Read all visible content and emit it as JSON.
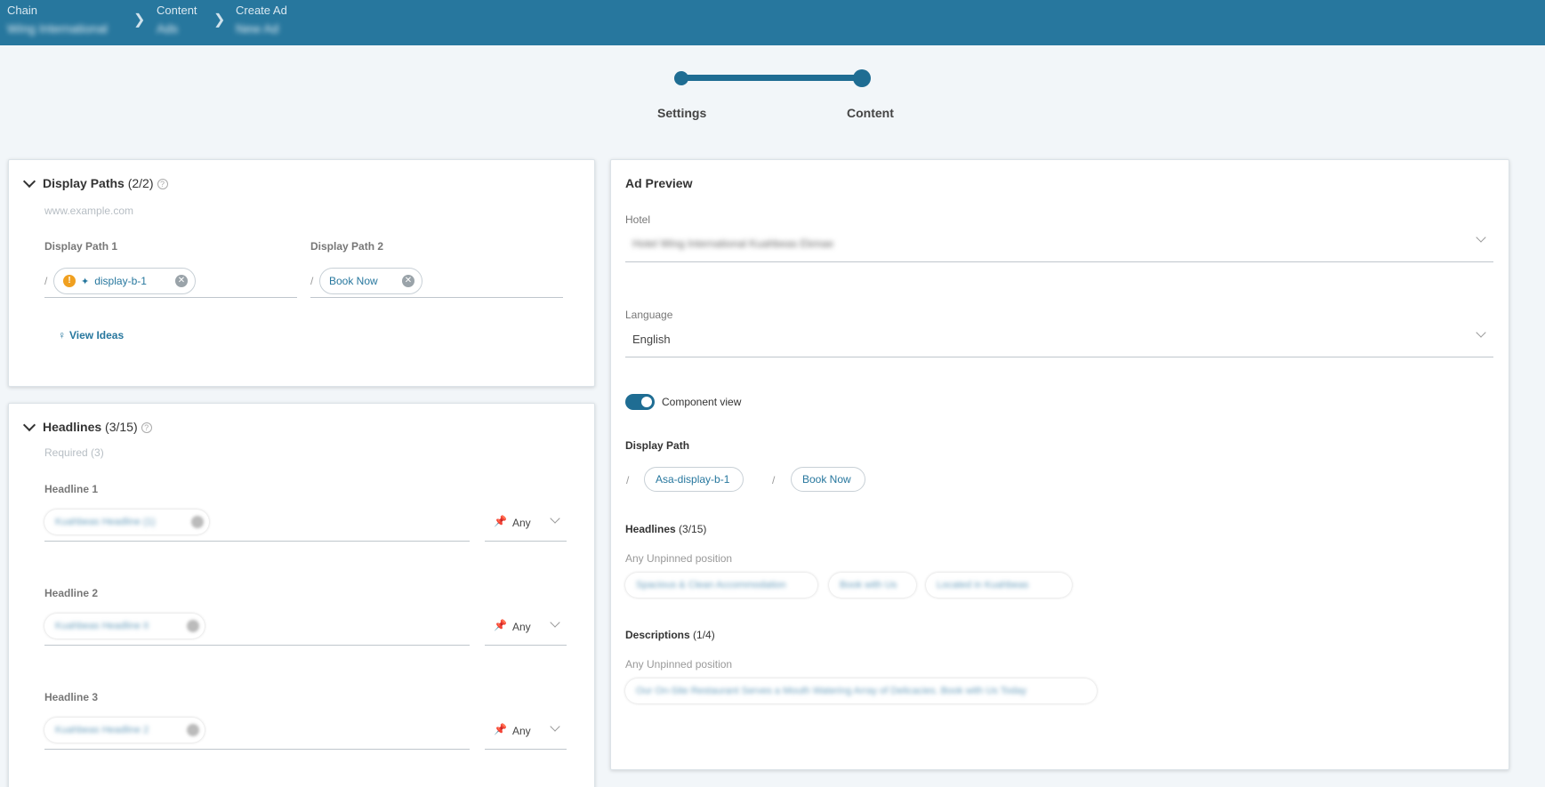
{
  "breadcrumb": [
    {
      "label": "Chain",
      "value": "Wing International"
    },
    {
      "label": "Content",
      "value": "Ads"
    },
    {
      "label": "Create Ad",
      "value": "New Ad"
    }
  ],
  "stepper": {
    "steps": [
      "Settings",
      "Content"
    ]
  },
  "display_paths": {
    "title": "Display Paths",
    "count": "(2/2)",
    "base_url": "www.example.com",
    "path1_label": "Display Path 1",
    "path2_label": "Display Path 2",
    "path1_value": "display-b-1",
    "path2_value": "Book Now",
    "separator": "/",
    "view_ideas": "View Ideas"
  },
  "headlines": {
    "title": "Headlines",
    "count": "(3/15)",
    "required": "Required (3)",
    "items": [
      {
        "label": "Headline 1",
        "value": "Kuahbeas Headline (1)",
        "pin": "Any"
      },
      {
        "label": "Headline 2",
        "value": "Kuahbeas Headline II",
        "pin": "Any"
      },
      {
        "label": "Headline 3",
        "value": "Kuahbeas Headline 2",
        "pin": "Any"
      }
    ]
  },
  "preview": {
    "title": "Ad Preview",
    "hotel_label": "Hotel",
    "hotel_value": "Hotel Wing International Kuahbeas Ekmae",
    "language_label": "Language",
    "language_value": "English",
    "component_view": "Component view",
    "display_path_label": "Display Path",
    "path1": "Asa-display-b-1",
    "path2": "Book Now",
    "separator": "/",
    "headlines_label": "Headlines",
    "headlines_count": "(3/15)",
    "unpinned_label": "Any Unpinned position",
    "headline_chips": [
      "Spacious & Clean Accommodation",
      "Book with Us",
      "Located in Kuahbeas"
    ],
    "descriptions_label": "Descriptions",
    "descriptions_count": "(1/4)",
    "description_unpinned_label": "Any Unpinned position",
    "description_chips": [
      "Our On-Site Restaurant Serves a Mouth Watering Array of Delicacies. Book with Us Today"
    ]
  },
  "colors": {
    "primary": "#27779e",
    "warning": "#f0a020"
  }
}
